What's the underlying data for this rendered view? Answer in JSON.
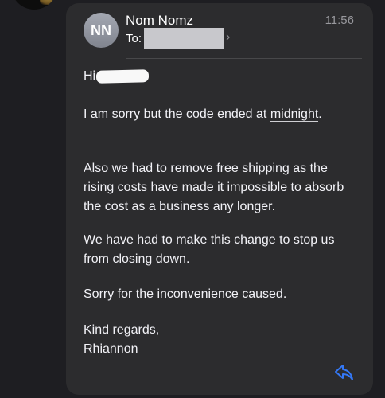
{
  "message": {
    "sender_initials": "NN",
    "sender_name": "Nom Nomz",
    "time": "11:56",
    "to_label": "To:",
    "greeting": "Hi",
    "line1_a": "I am sorry but the code ended at ",
    "line1_link": "midnight",
    "line1_b": ".",
    "para2": [
      "Also we had to remove free shipping as the",
      "rising costs have made it impossible to absorb",
      "the cost as a business any longer."
    ],
    "para3": [
      "We have had to make this change to stop us",
      "from closing down."
    ],
    "para4": "Sorry for the inconvenience caused.",
    "signoff": "Kind regards,",
    "signature": "Rhiannon"
  },
  "icons": {
    "reply": "reply-arrow-icon",
    "to_chevron": "chevron-right-icon"
  },
  "colors": {
    "background": "#1e1e22",
    "card": "#2c2c2e",
    "reply_icon": "#3478f6"
  }
}
